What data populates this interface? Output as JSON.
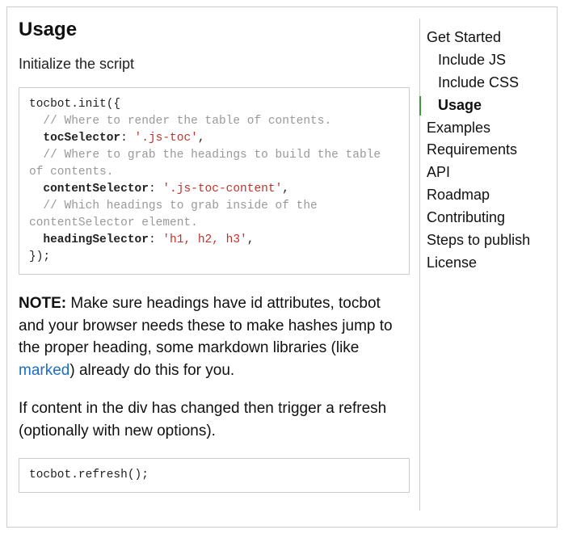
{
  "heading": "Usage",
  "intro": "Initialize the script",
  "code1": {
    "l1": "tocbot.init({",
    "c1": "  // Where to render the table of contents.",
    "k1": "  tocSelector",
    "s1": "'.js-toc'",
    "p1": ",",
    "c2": "  // Where to grab the headings to build the table of contents.",
    "k2": "  contentSelector",
    "s2": "'.js-toc-content'",
    "p2": ",",
    "c3": "  // Which headings to grab inside of the contentSelector element.",
    "k3": "  headingSelector",
    "s3": "'h1, h2, h3'",
    "p3": ",",
    "l2": "});"
  },
  "note_bold": "NOTE:",
  "note_text1": " Make sure headings have id attributes, tocbot and your browser needs these to make hashes jump to the proper heading, some markdown libraries (like ",
  "note_link": "marked",
  "note_text2": ") already do this for you.",
  "para2": "If content in the div has changed then trigger a refresh (optionally with new options).",
  "code2": "tocbot.refresh();",
  "toc": {
    "get_started": "Get Started",
    "include_js": "Include JS",
    "include_css": "Include CSS",
    "usage": "Usage",
    "examples": "Examples",
    "requirements": "Requirements",
    "api": "API",
    "roadmap": "Roadmap",
    "contributing": "Contributing",
    "steps": "Steps to publish",
    "license": "License"
  }
}
